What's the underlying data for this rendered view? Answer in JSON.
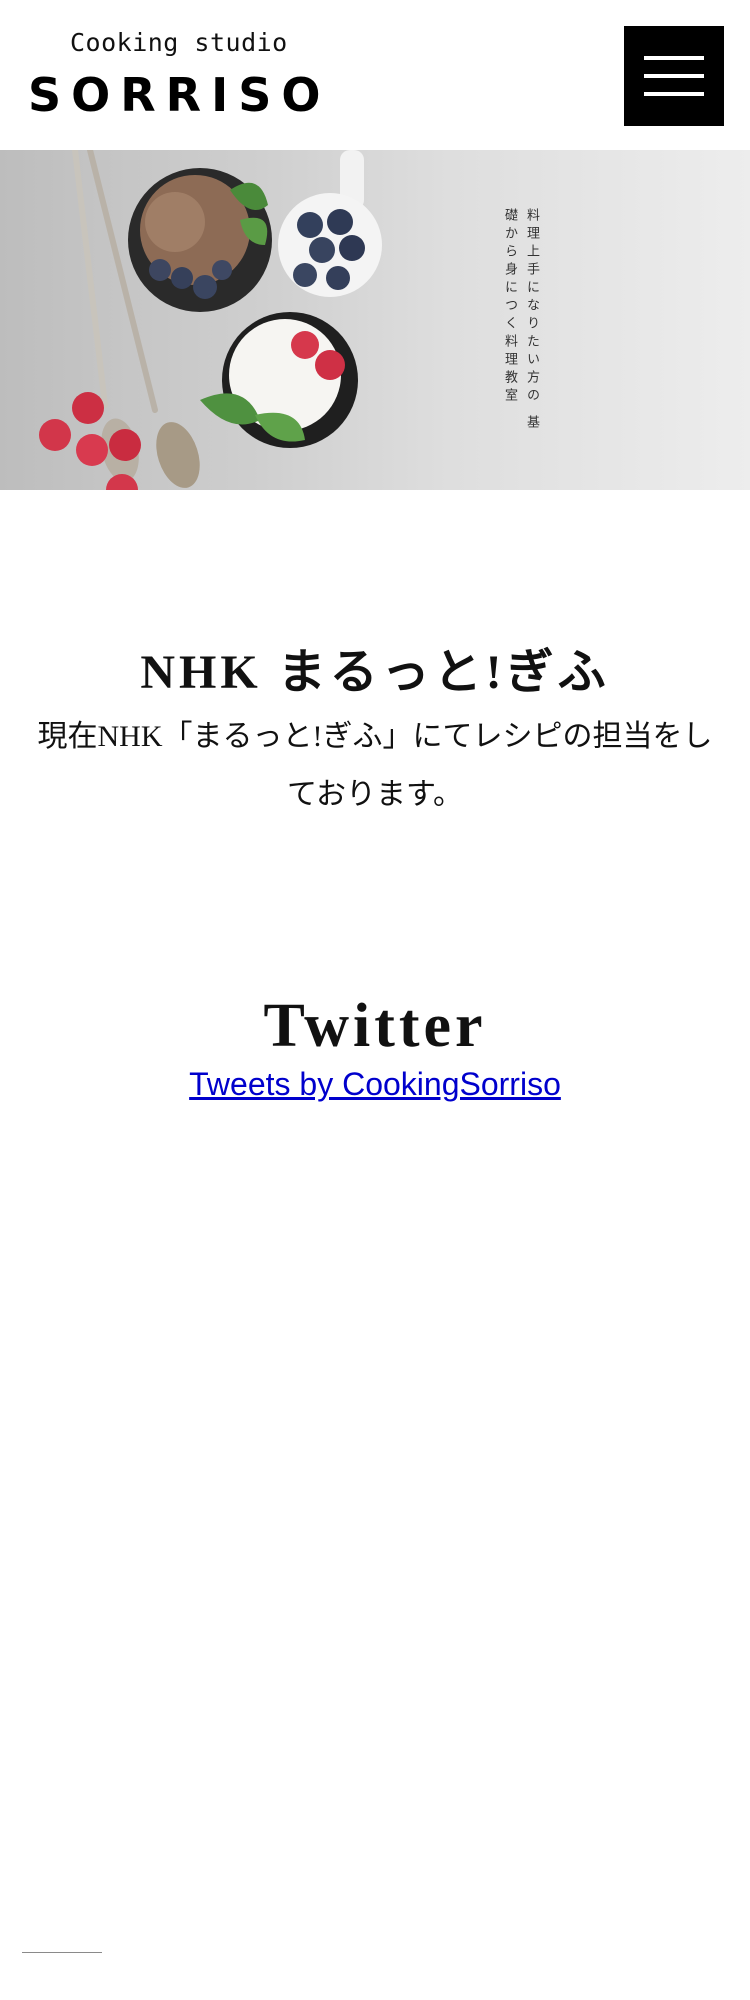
{
  "header": {
    "brand_sub": "Cooking studio",
    "brand_name": "SORRISO",
    "menu_icon": "hamburger-icon"
  },
  "hero": {
    "tagline": "料理上手になりたい方の 基礎から身につく料理教室"
  },
  "nhk": {
    "title": "NHK まるっと!ぎふ",
    "body": "現在NHK「まるっと!ぎふ」にてレシピの担当をしております。"
  },
  "twitter": {
    "title": "Twitter",
    "link_text": "Tweets by CookingSorriso"
  },
  "colors": {
    "text": "#111111",
    "link": "#0000cc",
    "menu_bg": "#000000"
  }
}
